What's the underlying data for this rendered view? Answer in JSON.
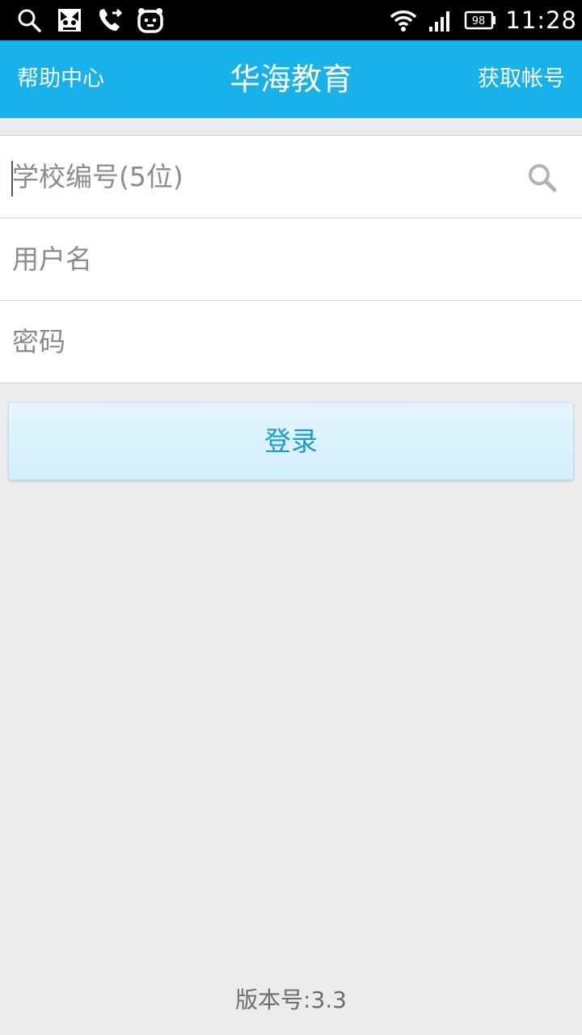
{
  "status_bar": {
    "time": "11:28",
    "battery": "98",
    "left_icons": [
      "search-icon",
      "cat-icon",
      "phone-forward-icon",
      "bear-icon"
    ],
    "right_icons": [
      "wifi-icon",
      "signal-icon",
      "battery-icon"
    ]
  },
  "app_bar": {
    "left_label": "帮助中心",
    "title": "华海教育",
    "right_label": "获取帐号",
    "color": "#17b2ea"
  },
  "form": {
    "school_id": {
      "placeholder": "学校编号(5位)",
      "value": ""
    },
    "username": {
      "placeholder": "用户名",
      "value": ""
    },
    "password": {
      "placeholder": "密码",
      "value": ""
    }
  },
  "login_button": {
    "label": "登录"
  },
  "footer": {
    "version": "版本号:3.3"
  }
}
